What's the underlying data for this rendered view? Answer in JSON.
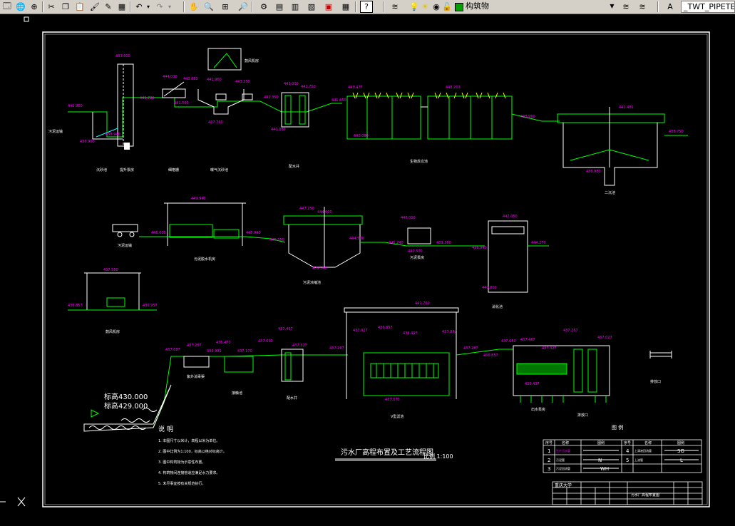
{
  "toolbar": {
    "layer_name": "构筑物",
    "text_style": "_TWT_PIPETEX",
    "colors": {
      "bg": "#d4d0c8",
      "accent": "#00a000"
    }
  },
  "drawing": {
    "title": "污水厂高程布置及工艺流程图",
    "scale": "比例 1:100",
    "elev_430": "标高430.000",
    "elev_429": "标高429.000",
    "notes_heading": "说 明",
    "notes": [
      "1. 本图尺寸以米计，高程以米为单位。",
      "2. 图中比例为1:100，标高以绝对标高计。",
      "3. 图中构筑物为示意性布置。",
      "4. 构筑物间连接管道应满足水力要求。",
      "5. 未尽事宜按有关规范执行。"
    ],
    "legend_heading": "图 例",
    "legend_header": [
      "序号",
      "名称",
      "图例",
      "序号",
      "名称",
      "图例"
    ],
    "legend_rows": [
      {
        "n1": "1",
        "name1": "生产污水管",
        "sym1": "",
        "n2": "4",
        "name2": "上清液回流管",
        "sym2": "SG"
      },
      {
        "n1": "2",
        "name1": "污泥管",
        "sym1": "N",
        "n2": "5",
        "name2": "上流管",
        "sym2": "L"
      },
      {
        "n1": "3",
        "name1": "污泥回流管",
        "sym1": "WH",
        "n2": "",
        "name2": "",
        "sym2": ""
      }
    ],
    "titleblock_school": "重庆大学",
    "titleblock_name": "污水厂高程布置图",
    "elevations": {
      "e1": "443.800",
      "e2": "441.900",
      "e3": "438.940",
      "e4": "436.960",
      "e5": "444.030",
      "e6": "443.880",
      "e7": "442.780",
      "e8": "441.560",
      "e9": "441.960",
      "e10": "437.760",
      "e11": "443.350",
      "e12": "443.000",
      "e13": "442.750",
      "e14": "442.350",
      "e15": "441.650",
      "e16": "443.477",
      "e17": "443.203",
      "e18": "440.080",
      "e19": "440.080",
      "e20": "441.481",
      "e21": "438.750",
      "e22": "438.960",
      "e23": "436.980",
      "e24": "449.940",
      "e25": "446.600",
      "e26": "445.940",
      "e27": "447.250",
      "e28": "444.000",
      "e29": "445.350",
      "e30": "444.580",
      "e31": "446.000",
      "e32": "441.240",
      "e33": "440.500",
      "e34": "439.360",
      "e35": "439.340",
      "e36": "436.940",
      "e37": "437.550",
      "e38": "436.857",
      "e39": "436.957",
      "e40": "437.887",
      "e41": "437.287",
      "e42": "436.981",
      "e43": "436.470",
      "e44": "437.170",
      "e45": "437.650",
      "e46": "437.467",
      "e47": "437.327",
      "e48": "437.267",
      "e49": "437.027",
      "e50": "436.857",
      "e51": "436.497",
      "e52": "447.050",
      "e53": "444.270",
      "e54": "440.800",
      "e55": "441.760"
    },
    "labels": {
      "grit": "沉砂池",
      "screen": "细格栅",
      "pump": "提升泵房",
      "aer": "曝气沉砂池",
      "bio": "生物反应池",
      "sec": "二沉池",
      "sludge_house": "污泥脱水机房",
      "thick": "污泥浓缩池",
      "sludge_pump": "污泥泵房",
      "digest": "消化池",
      "blower": "鼓风机房",
      "filter": "V型滤池",
      "contact": "接触池",
      "well": "配水井",
      "uv": "紫外消毒渠",
      "out": "出水泵房",
      "dis": "排放口",
      "road": "污泥运输"
    }
  }
}
